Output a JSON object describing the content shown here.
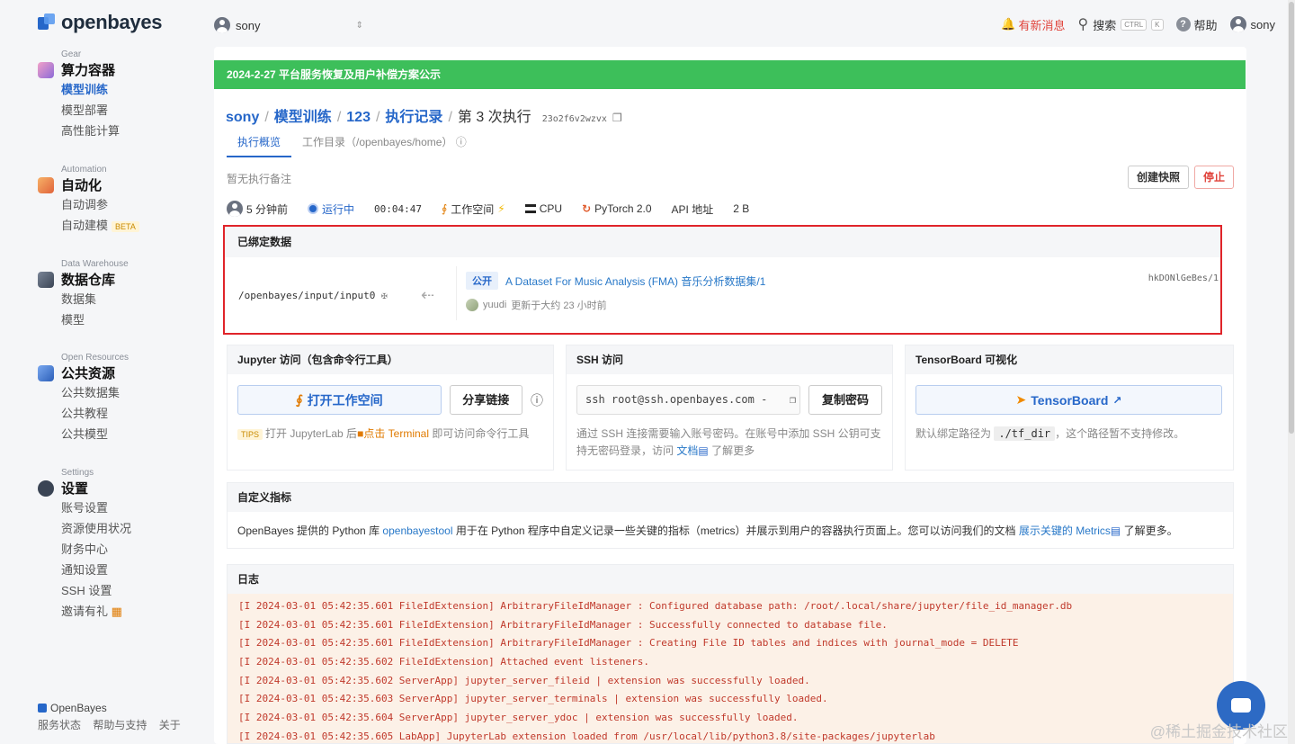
{
  "app": {
    "logo_text": "openbayes",
    "accent": "#2667c9"
  },
  "sidebar": {
    "groups": [
      {
        "category": "Gear",
        "title": "算力容器",
        "items": [
          "模型训练",
          "模型部署",
          "高性能计算"
        ]
      },
      {
        "category": "Automation",
        "title": "自动化",
        "items": [
          "自动调参",
          "自动建模"
        ],
        "beta": "BETA"
      },
      {
        "category": "Data Warehouse",
        "title": "数据仓库",
        "items": [
          "数据集",
          "模型"
        ]
      },
      {
        "category": "Open Resources",
        "title": "公共资源",
        "items": [
          "公共数据集",
          "公共教程",
          "公共模型"
        ]
      },
      {
        "category": "Settings",
        "title": "设置",
        "items": [
          "账号设置",
          "资源使用状况",
          "财务中心",
          "通知设置",
          "SSH 设置",
          "邀请有礼"
        ]
      }
    ],
    "footer": {
      "brand": "OpenBayes",
      "links": [
        "服务状态",
        "帮助与支持",
        "关于"
      ]
    }
  },
  "topbar": {
    "user_select": "sony",
    "notification": "有新消息",
    "search": "搜索",
    "kbd_ctrl": "CTRL",
    "kbd_k": "K",
    "help": "帮助",
    "user": "sony"
  },
  "banner": "2024-2-27 平台服务恢复及用户补偿方案公示",
  "breadcrumb": {
    "items": [
      "sony",
      "模型训练",
      "123",
      "执行记录"
    ],
    "current": "第 3 次执行",
    "hash": "23o2f6v2wzvx"
  },
  "tabs": [
    "执行概览",
    "工作目录（/openbayes/home）"
  ],
  "note": "暂无执行备注",
  "actions": {
    "snapshot": "创建快照",
    "stop": "停止"
  },
  "status": {
    "age": "5 分钟前",
    "state": "运行中",
    "duration": "00:04:47",
    "workspace": "工作空间",
    "cpu": "CPU",
    "framework": "PyTorch 2.0",
    "api": "API 地址",
    "size": "2 B"
  },
  "bound_data": {
    "title": "已绑定数据",
    "mount_path": "/openbayes/input/input0",
    "badge": "公开",
    "dataset_title": "A Dataset For Music Analysis (FMA) 音乐分析数据集/1",
    "dataset_id": "hkDONlGeBes/1",
    "owner": "yuudi",
    "updated": "更新于大约 23 小时前"
  },
  "jupyter": {
    "title": "Jupyter 访问（包含命令行工具）",
    "open_btn": "打开工作空间",
    "share_btn": "分享链接",
    "tips": "TIPS",
    "hint_1": "打开 JupyterLab 后",
    "hint_terminal": "点击 Terminal",
    "hint_2": "即可访问命令行工具"
  },
  "ssh": {
    "title": "SSH 访问",
    "command": "ssh root@ssh.openbayes.com -",
    "copy_btn": "复制密码",
    "hint_1": "通过 SSH 连接需要输入账号密码。在账号中添加 SSH 公钥可支持无密码登录，访问",
    "hint_link": "文档",
    "hint_2": "了解更多"
  },
  "tensorboard": {
    "title": "TensorBoard 可视化",
    "btn": "TensorBoard",
    "hint_1": "默认绑定路径为",
    "path": "./tf_dir",
    "hint_2": "，这个路径暂不支持修改。"
  },
  "metrics": {
    "title": "自定义指标",
    "text_1": "OpenBayes 提供的 Python 库",
    "lib": "openbayestool",
    "text_2": "用于在 Python 程序中自定义记录一些关键的指标（metrics）并展示到用户的容器执行页面上。您可以访问我们的文档",
    "link": "展示关键的 Metrics",
    "text_3": "了解更多。"
  },
  "logs": {
    "title": "日志",
    "lines": [
      "[I 2024-03-01 05:42:35.601 FileIdExtension] ArbitraryFileIdManager : Configured database path: /root/.local/share/jupyter/file_id_manager.db",
      "[I 2024-03-01 05:42:35.601 FileIdExtension] ArbitraryFileIdManager : Successfully connected to database file.",
      "[I 2024-03-01 05:42:35.601 FileIdExtension] ArbitraryFileIdManager : Creating File ID tables and indices with journal_mode = DELETE",
      "[I 2024-03-01 05:42:35.602 FileIdExtension] Attached event listeners.",
      "[I 2024-03-01 05:42:35.602 ServerApp] jupyter_server_fileid | extension was successfully loaded.",
      "[I 2024-03-01 05:42:35.603 ServerApp] jupyter_server_terminals | extension was successfully loaded.",
      "[I 2024-03-01 05:42:35.604 ServerApp] jupyter_server_ydoc | extension was successfully loaded.",
      "[I 2024-03-01 05:42:35.605 LabApp] JupyterLab extension loaded from /usr/local/lib/python3.8/site-packages/jupyterlab"
    ]
  },
  "watermark": "@稀土掘金技术社区"
}
